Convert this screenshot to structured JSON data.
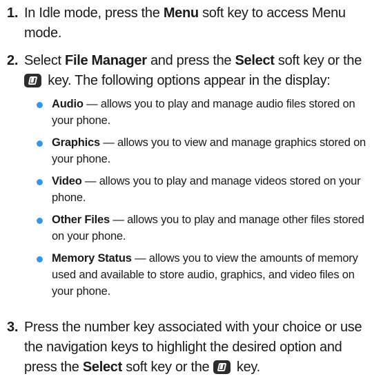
{
  "steps": [
    {
      "number": "1.",
      "parts": [
        "In Idle mode, press the ",
        "Menu",
        " soft key to access Menu mode."
      ]
    },
    {
      "number": "2.",
      "parts": [
        "Select ",
        "File Manager",
        " and press the ",
        "Select",
        " soft key or the",
        " key. The following options appear in the display:"
      ]
    },
    {
      "number": "3.",
      "parts": [
        "Press the number key associated with your choice or use the navigation keys to highlight the desired option and press the ",
        "Select",
        " soft key or the ",
        " key."
      ]
    }
  ],
  "options": [
    {
      "title": "Audio",
      "desc": " — allows you to play and manage audio files stored on your phone."
    },
    {
      "title": "Graphics",
      "desc": " — allows you to view and manage graphics stored on your phone."
    },
    {
      "title": "Video",
      "desc": " — allows you to play and manage videos stored on your phone."
    },
    {
      "title": "Other Files",
      "desc": " — allows you to play and manage other files stored on your phone."
    },
    {
      "title": "Memory Status",
      "desc": " — allows you to view the amounts of memory used and available to store audio, graphics, and video files on your phone."
    }
  ],
  "icons": {
    "key": "ok-key-icon"
  },
  "colors": {
    "bullet": "#3399e6",
    "text": "#1a1a1a"
  }
}
